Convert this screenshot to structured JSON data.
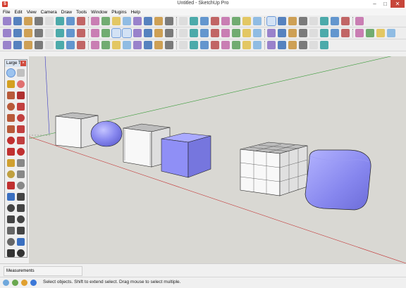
{
  "window": {
    "title": "Untitled - SketchUp Pro",
    "app_icon_letter": "S",
    "minimize": "–",
    "maximize": "□",
    "close": "✕"
  },
  "menu": [
    "File",
    "Edit",
    "View",
    "Camera",
    "Draw",
    "Tools",
    "Window",
    "Plugins",
    "Help"
  ],
  "toolbar_panel": {
    "title": "Large T...",
    "close": "×"
  },
  "measurements": {
    "label": "Measurements",
    "value": ""
  },
  "status": {
    "text": "Select objects. Shift to extend select. Drag mouse to select multiple."
  },
  "colors": {
    "accent": "#5a8ed6",
    "shape_face": "#8c8cf0",
    "sky": "#d9d8d3",
    "red_axis": "#c43a3a",
    "green_axis": "#3a9c3a",
    "blue_axis": "#3a3ac4"
  },
  "icons": {
    "row1": [
      "cube-icon",
      "cube-blue-icon",
      "cube-edge-icon",
      "cube-hidden-icon",
      "cube-shaded-icon",
      "cube-texture-icon",
      "cube-mono-icon",
      "cube-xray-icon",
      "shadow-icon",
      "layer-icon",
      "component-icon",
      "protractor-icon",
      "follow-icon",
      "pushpull-icon",
      "paint-icon",
      "section-icon",
      "fog-icon",
      "scene-icon",
      "warehouse-icon",
      "sandbox-icon",
      "settings-icon",
      "user-icon",
      "view-icon",
      "box-icon",
      "box2-icon",
      "house-icon",
      "house2-icon",
      "door-icon",
      "floor-icon",
      "book-icon",
      "puzzle-icon",
      "info-icon",
      "panel-icon"
    ],
    "row2": [
      "orbit-icon",
      "pan-icon",
      "zoom-icon",
      "zoom-window-icon",
      "zoom-extents-icon",
      "prev-view-icon",
      "next-view-icon",
      "house-view-icon",
      "components-icon",
      "materials-icon",
      "select-icon",
      "lock-icon",
      "cross-icon",
      "paint-bucket-icon",
      "group-icon",
      "explode-icon",
      "line-icon",
      "rect-icon",
      "circle-icon",
      "polygon-icon",
      "arc-icon",
      "eraser-icon",
      "push-icon",
      "offset-icon",
      "move-icon",
      "rotate-icon",
      "scale-icon",
      "tape-icon",
      "dim-icon",
      "text-icon",
      "axes-icon",
      "3dtext-icon",
      "walk-icon",
      "look-icon",
      "section2-icon",
      "outliner-icon"
    ],
    "row3": [
      "pencil-icon",
      "brush-icon",
      "circle-tool-icon",
      "ellipse-icon",
      "rect-tool-icon",
      "oval-icon",
      "shape-icon",
      "curve-icon",
      "arc-tool-icon",
      "spiral-icon",
      "chain-icon",
      "magnet-icon",
      "hook-icon",
      "scissors-icon",
      "sparkle-icon",
      "pin-icon",
      "stamp-icon",
      "arrow-up-icon",
      "drape-icon",
      "smoove-icon",
      "arrow-down-icon",
      "flip-icon",
      "mirror-icon",
      "split-icon",
      "node-icon",
      "join-icon",
      "path-icon",
      "wave-icon",
      "grab-icon",
      "knife-icon"
    ]
  }
}
